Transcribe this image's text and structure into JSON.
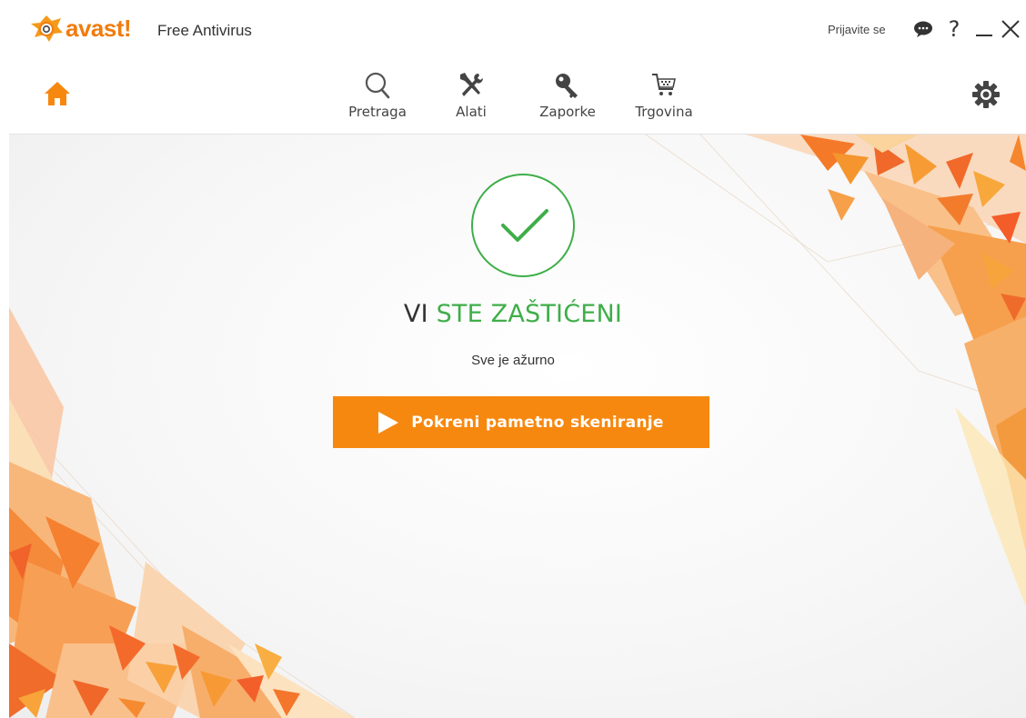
{
  "app": {
    "brand": "avast!",
    "product": "Free Antivirus"
  },
  "titlebar": {
    "signin_label": "Prijavite se",
    "help_label": "?",
    "icons": [
      "chat-bubble-icon",
      "help-icon",
      "minimize-icon",
      "close-icon"
    ]
  },
  "nav": {
    "home_icon": "home-icon",
    "items": [
      {
        "label": "Pretraga",
        "icon": "search-icon"
      },
      {
        "label": "Alati",
        "icon": "tools-icon"
      },
      {
        "label": "Zaporke",
        "icon": "key-icon"
      },
      {
        "label": "Trgovina",
        "icon": "cart-icon"
      }
    ],
    "settings_icon": "gear-icon"
  },
  "status": {
    "title_prefix": "VI",
    "title_highlight": "STE ZAŠTIĆENI",
    "subtitle": "Sve je ažurno",
    "icon": "checkmark-icon"
  },
  "scan": {
    "label": "Pokreni pametno skeniranje",
    "icon": "play-icon"
  },
  "colors": {
    "accent_orange": "#f7880f",
    "status_green": "#3fae49",
    "brand_orange": "#f07c0e"
  }
}
